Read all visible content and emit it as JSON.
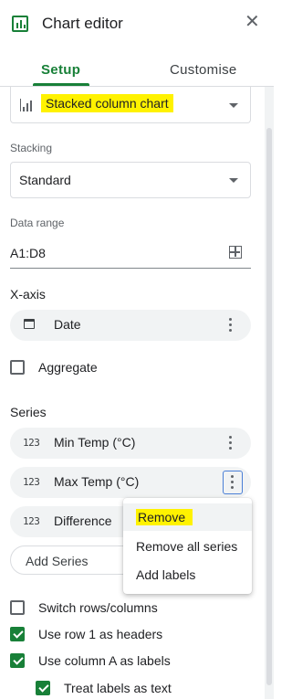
{
  "header": {
    "title": "Chart editor",
    "close_icon": "close-icon"
  },
  "tabs": [
    {
      "label": "Setup",
      "active": true
    },
    {
      "label": "Customise",
      "active": false
    }
  ],
  "chart_type": {
    "value": "Stacked column chart",
    "icon": "column-chart-icon",
    "highlight_color": "#fff200"
  },
  "stacking": {
    "label": "Stacking",
    "value": "Standard"
  },
  "data_range": {
    "label": "Data range",
    "value": "A1:D8",
    "icon": "grid-icon"
  },
  "x_axis": {
    "heading": "X-axis",
    "item": {
      "label": "Date",
      "icon": "calendar-icon"
    }
  },
  "aggregate": {
    "label": "Aggregate",
    "checked": false
  },
  "series": {
    "heading": "Series",
    "items": [
      {
        "icon_text": "123",
        "label": "Min Temp (°C)"
      },
      {
        "icon_text": "123",
        "label": "Max Temp (°C)"
      },
      {
        "icon_text": "123",
        "label": "Difference"
      }
    ],
    "add_label": "Add Series"
  },
  "context_menu": {
    "items": [
      {
        "label": "Remove",
        "hovered": true
      },
      {
        "label": "Remove all series"
      },
      {
        "label": "Add labels"
      }
    ]
  },
  "options": [
    {
      "label": "Switch rows/columns",
      "checked": false
    },
    {
      "label": "Use row 1 as headers",
      "checked": true
    },
    {
      "label": "Use column A as labels",
      "checked": true
    },
    {
      "label": "Treat labels as text",
      "checked": true
    }
  ],
  "colors": {
    "accent": "#188038",
    "highlight": "#fff200",
    "pill_bg": "#f1f3f4"
  }
}
